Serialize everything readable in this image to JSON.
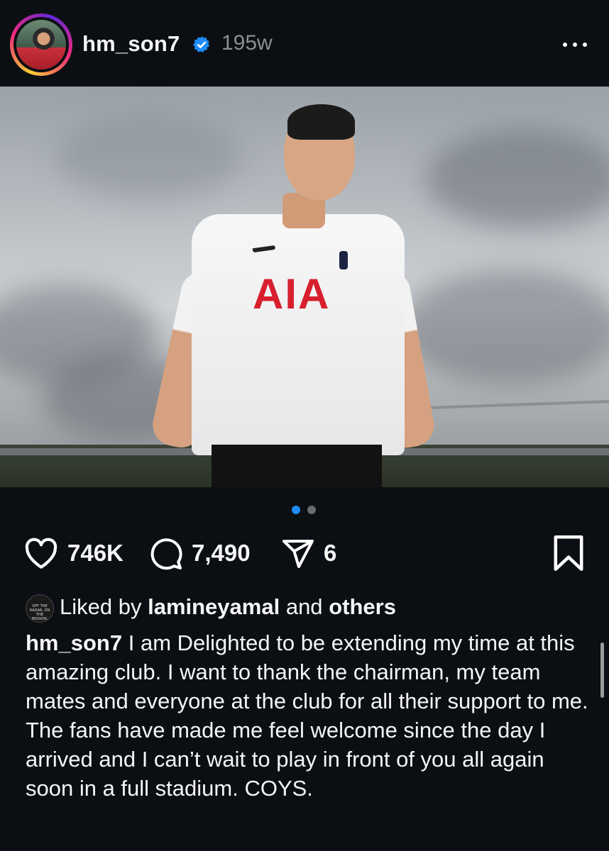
{
  "post": {
    "username": "hm_son7",
    "verified": true,
    "age": "195w",
    "more_icon": "more-horizontal-icon"
  },
  "photo": {
    "shirt_sponsor": "AIA",
    "carousel": {
      "count": 2,
      "active_index": 0,
      "active_color": "#1d8cf8",
      "inactive_color": "#6b6b6b"
    }
  },
  "actions": {
    "likes": "746K",
    "comments": "7,490",
    "shares": "6"
  },
  "liked_by": {
    "prefix": "Liked by",
    "user": "lamineyamal",
    "connector": "and",
    "suffix": "others",
    "avatar_text": "OFF THE RADAR, ON THE MISSION."
  },
  "caption": {
    "username": "hm_son7",
    "text": "I am Delighted to be extending my time at this amazing club. I want to thank the chairman, my team mates and everyone at the club for all their support to me. The fans have made me feel welcome since the day I arrived and I can’t wait to play in front of you all again soon in a full stadium. COYS."
  },
  "colors": {
    "background": "#0b0f14",
    "verified_blue": "#1d8cf8",
    "muted_text": "#8e8e8e"
  }
}
